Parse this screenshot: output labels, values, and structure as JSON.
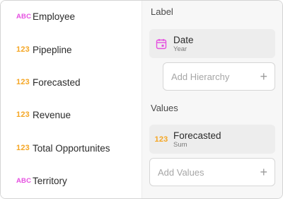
{
  "fields": [
    {
      "type_label": "ABC",
      "kind": "text",
      "label": "Employee"
    },
    {
      "type_label": "123",
      "kind": "number",
      "label": "Pipepline"
    },
    {
      "type_label": "123",
      "kind": "number",
      "label": "Forecasted"
    },
    {
      "type_label": "123",
      "kind": "number",
      "label": "Revenue"
    },
    {
      "type_label": "123",
      "kind": "number",
      "label": "Total Opportunites"
    },
    {
      "type_label": "ABC",
      "kind": "text",
      "label": "Territory"
    }
  ],
  "label_section": {
    "title": "Label",
    "item": {
      "icon": "calendar-icon",
      "title": "Date",
      "subtitle": "Year"
    },
    "add_label": "Add Hierarchy"
  },
  "values_section": {
    "title": "Values",
    "item": {
      "type_label": "123",
      "title": "Forecasted",
      "subtitle": "Sum"
    },
    "add_label": "Add Values"
  },
  "colors": {
    "text_type": "#e54ee0",
    "number_type": "#f5a623",
    "calendar_icon": "#e54ee0"
  },
  "icons": {
    "plus": "+"
  }
}
